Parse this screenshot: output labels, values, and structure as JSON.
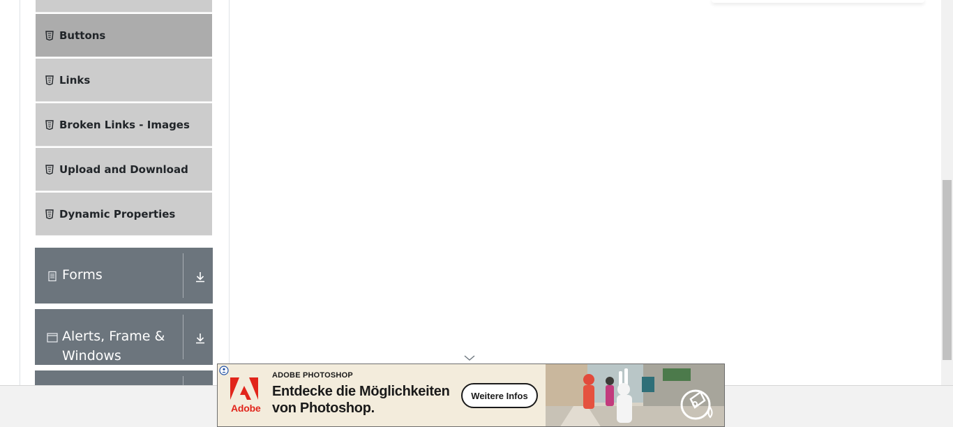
{
  "sidebar": {
    "items": [
      {
        "label": "Buttons",
        "icon": "html5-icon",
        "active": true
      },
      {
        "label": "Links",
        "icon": "html5-icon"
      },
      {
        "label": "Broken Links - Images",
        "icon": "html5-icon"
      },
      {
        "label": "Upload and Download",
        "icon": "html5-icon"
      },
      {
        "label": "Dynamic Properties",
        "icon": "html5-icon"
      }
    ],
    "groups": [
      {
        "label": "Forms",
        "icon": "document-icon",
        "arrow": "download-arrow-icon"
      },
      {
        "label": "Alerts, Frame & Windows",
        "icon": "window-icon",
        "arrow": "download-arrow-icon"
      }
    ]
  },
  "ad": {
    "brand": "ADOBE PHOTOSHOP",
    "headline_line1": "Entdecke die Möglichkeiten",
    "headline_line2": "von Photoshop.",
    "cta": "Weitere Infos",
    "logo_text": "Adobe",
    "colors": {
      "adobe_red": "#e1251b",
      "background": "#f3ecdc"
    }
  },
  "colors": {
    "menu_item_bg": "#cccccc",
    "menu_item_active_bg": "#acacac",
    "group_header_bg": "#6c757d"
  }
}
